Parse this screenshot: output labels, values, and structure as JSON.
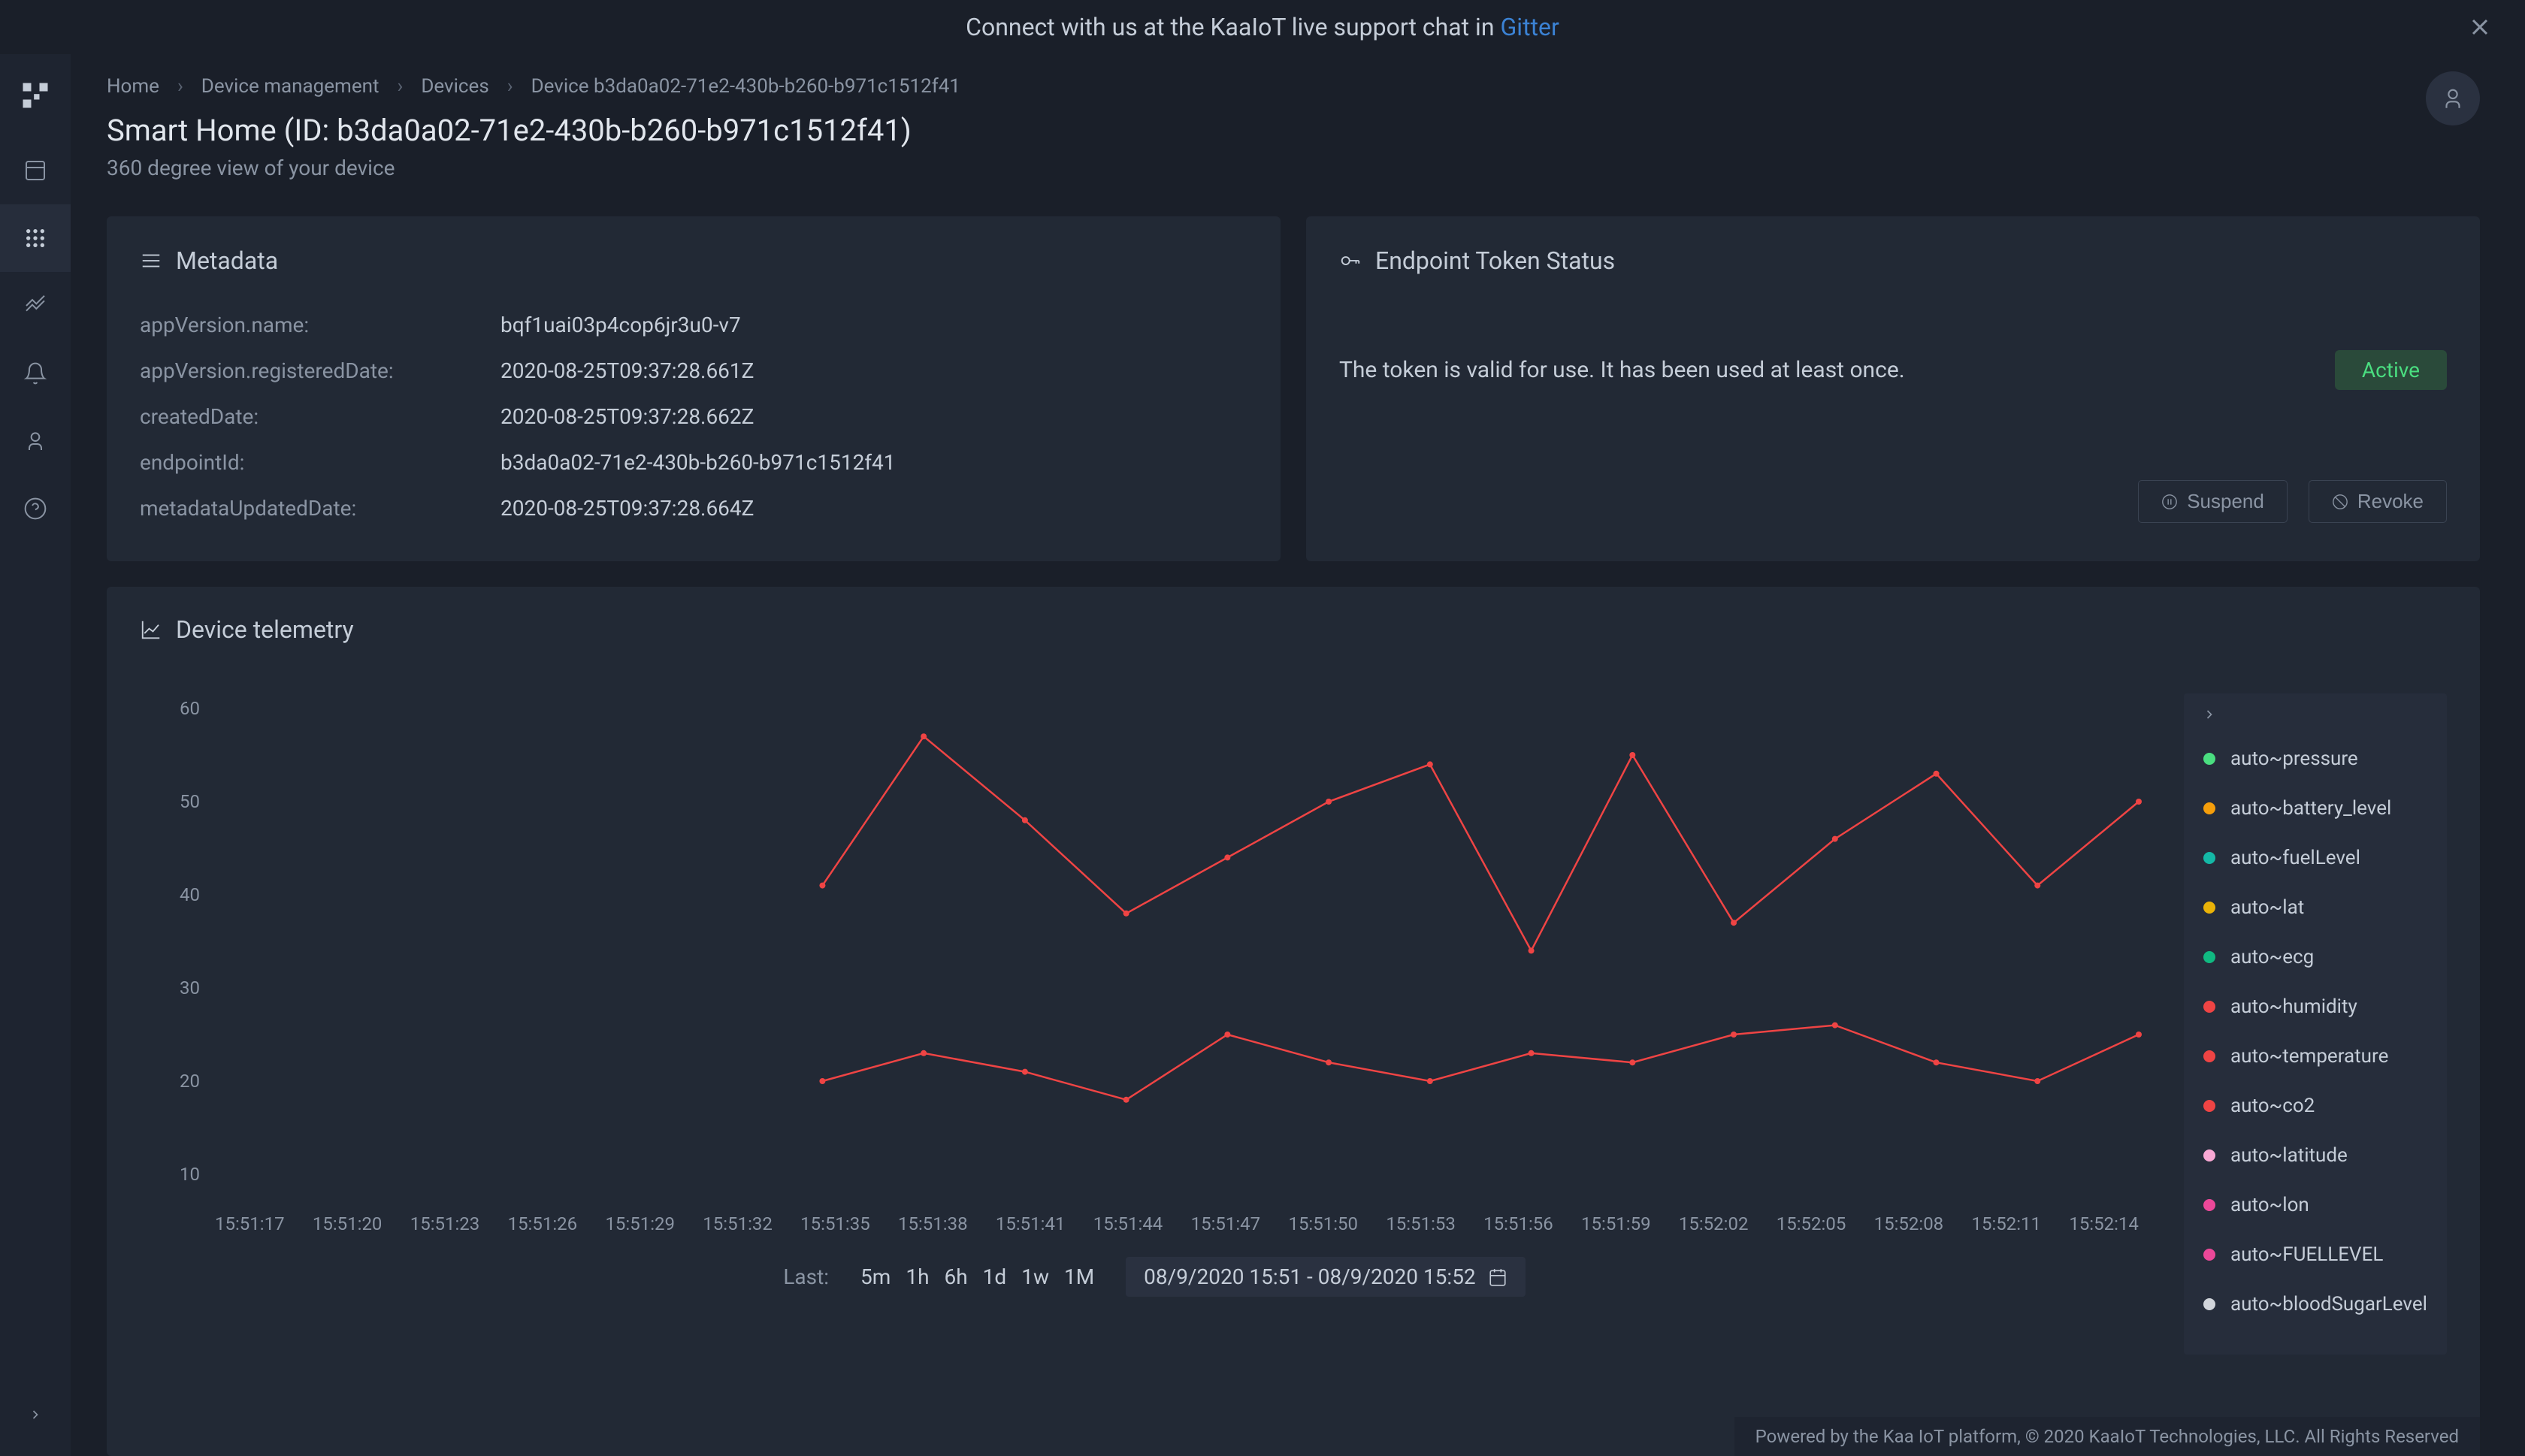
{
  "banner": {
    "text": "Connect with us at the KaaIoT live support chat in",
    "link": "Gitter"
  },
  "breadcrumb": [
    "Home",
    "Device management",
    "Devices",
    "Device b3da0a02-71e2-430b-b260-b971c1512f41"
  ],
  "page": {
    "title": "Smart Home (ID: b3da0a02-71e2-430b-b260-b971c1512f41)",
    "subtitle": "360 degree view of your device"
  },
  "metadata": {
    "title": "Metadata",
    "rows": [
      {
        "label": "appVersion.name:",
        "value": "bqf1uai03p4cop6jr3u0-v7"
      },
      {
        "label": "appVersion.registeredDate:",
        "value": "2020-08-25T09:37:28.661Z"
      },
      {
        "label": "createdDate:",
        "value": "2020-08-25T09:37:28.662Z"
      },
      {
        "label": "endpointId:",
        "value": "b3da0a02-71e2-430b-b260-b971c1512f41"
      },
      {
        "label": "metadataUpdatedDate:",
        "value": "2020-08-25T09:37:28.664Z"
      }
    ]
  },
  "token": {
    "title": "Endpoint Token Status",
    "message": "The token is valid for use. It has been used at least once.",
    "status": "Active",
    "suspend": "Suspend",
    "revoke": "Revoke"
  },
  "telemetry": {
    "title": "Device telemetry",
    "time_label": "Last:",
    "ranges": [
      "5m",
      "1h",
      "6h",
      "1d",
      "1w",
      "1M"
    ],
    "date_range": "08/9/2020 15:51 - 08/9/2020 15:52",
    "legend": [
      {
        "name": "auto~pressure",
        "color": "#4ade80"
      },
      {
        "name": "auto~battery_level",
        "color": "#f59e0b"
      },
      {
        "name": "auto~fuelLevel",
        "color": "#14b8a6"
      },
      {
        "name": "auto~lat",
        "color": "#eab308"
      },
      {
        "name": "auto~ecg",
        "color": "#10b981"
      },
      {
        "name": "auto~humidity",
        "color": "#ef4444"
      },
      {
        "name": "auto~temperature",
        "color": "#ef4444"
      },
      {
        "name": "auto~co2",
        "color": "#ef4444"
      },
      {
        "name": "auto~latitude",
        "color": "#f9a8d4"
      },
      {
        "name": "auto~lon",
        "color": "#ec4899"
      },
      {
        "name": "auto~FUELLEVEL",
        "color": "#ec4899"
      },
      {
        "name": "auto~bloodSugarLevel",
        "color": "#d1d5db"
      }
    ]
  },
  "footer": "Powered by the Kaa IoT platform, © 2020 KaaIoT Technologies, LLC. All Rights Reserved",
  "chart_data": {
    "type": "line",
    "xlabel": "",
    "ylabel": "",
    "ylim": [
      10,
      60
    ],
    "y_ticks": [
      10,
      20,
      30,
      40,
      50,
      60
    ],
    "x_ticks": [
      "15:51:17",
      "15:51:20",
      "15:51:23",
      "15:51:26",
      "15:51:29",
      "15:51:32",
      "15:51:35",
      "15:51:38",
      "15:51:41",
      "15:51:44",
      "15:51:47",
      "15:51:50",
      "15:51:53",
      "15:51:56",
      "15:51:59",
      "15:52:02",
      "15:52:05",
      "15:52:08",
      "15:52:11",
      "15:52:14"
    ],
    "series": [
      {
        "name": "auto~humidity",
        "color": "#ef4444",
        "x": [
          "15:51:35",
          "15:51:38",
          "15:51:41",
          "15:51:44",
          "15:51:47",
          "15:51:50",
          "15:51:53",
          "15:51:56",
          "15:51:59",
          "15:52:02",
          "15:52:05",
          "15:52:08",
          "15:52:11",
          "15:52:14"
        ],
        "values": [
          41,
          57,
          48,
          38,
          44,
          50,
          54,
          34,
          55,
          37,
          46,
          53,
          41,
          50
        ]
      },
      {
        "name": "auto~temperature",
        "color": "#ef4444",
        "x": [
          "15:51:35",
          "15:51:38",
          "15:51:41",
          "15:51:44",
          "15:51:47",
          "15:51:50",
          "15:51:53",
          "15:51:56",
          "15:51:59",
          "15:52:02",
          "15:52:05",
          "15:52:08",
          "15:52:11",
          "15:52:14"
        ],
        "values": [
          20,
          23,
          21,
          18,
          25,
          22,
          20,
          23,
          22,
          25,
          26,
          22,
          20,
          25
        ]
      }
    ]
  }
}
